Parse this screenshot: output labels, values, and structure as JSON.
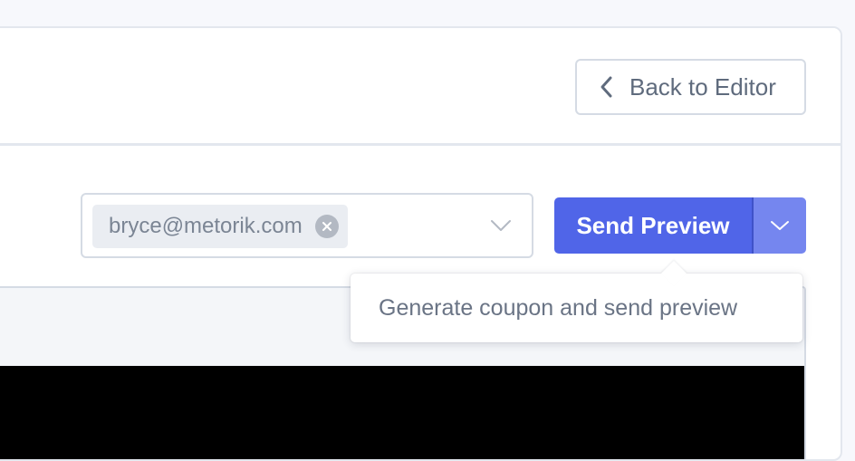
{
  "header": {
    "back_button_label": "Back to Editor",
    "back_icon": "chevron-left-icon"
  },
  "toolbar": {
    "recipient": {
      "email": "bryce@metorik.com",
      "remove_icon": "close-circle-icon",
      "dropdown_icon": "chevron-down-icon"
    },
    "send_button": {
      "label": "Send Preview",
      "dropdown_icon": "chevron-down-icon"
    }
  },
  "tooltip": {
    "text": "Generate coupon and send preview"
  },
  "colors": {
    "primary": "#5065e8",
    "primary_light": "#7586ef",
    "border": "#d5dbe4",
    "muted_text": "#5f6b7d"
  }
}
